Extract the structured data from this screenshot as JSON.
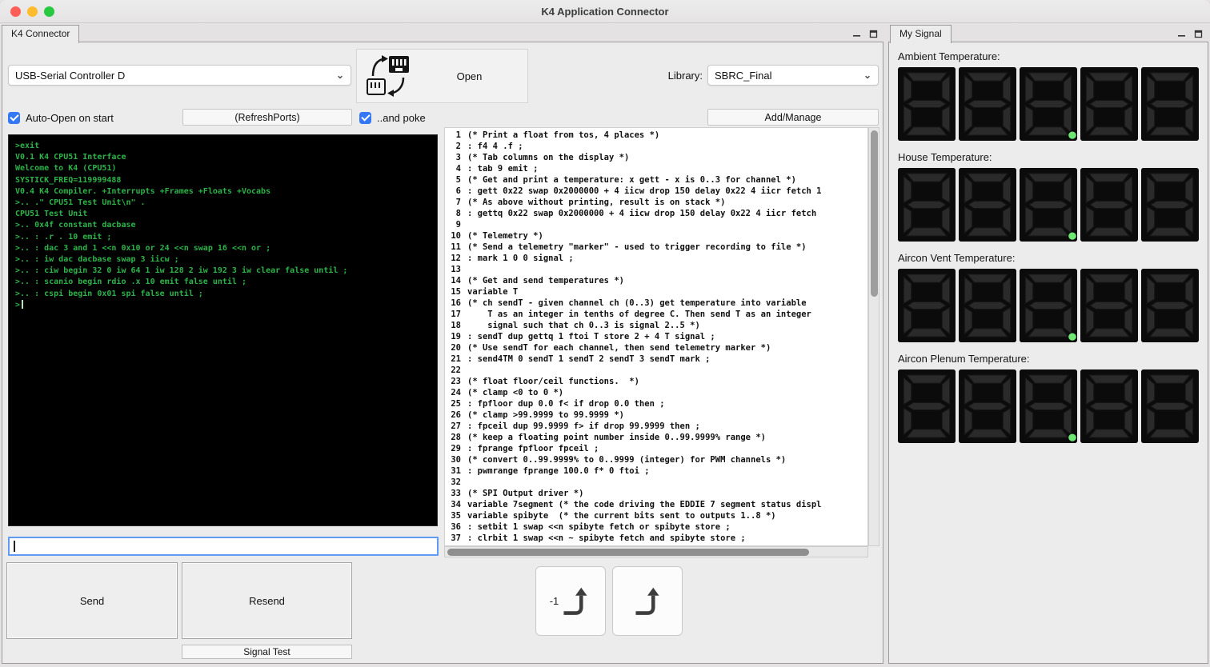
{
  "window": {
    "title": "K4 Application Connector"
  },
  "connector_panel": {
    "tab_label": "K4 Connector",
    "port_dropdown": {
      "value": "USB-Serial Controller D"
    },
    "open_button": {
      "label": "Open"
    },
    "library": {
      "label": "Library:",
      "value": "SBRC_Final"
    },
    "auto_open_checkbox": {
      "label": "Auto-Open on start",
      "checked": true
    },
    "refresh_button": {
      "label": "(RefreshPorts)"
    },
    "poke_checkbox": {
      "label": "..and poke",
      "checked": true
    },
    "add_manage_button": {
      "label": "Add/Manage"
    },
    "terminal": {
      "lines": [
        ">exit",
        "V0.1 K4 CPU51 Interface",
        "Welcome to K4 (CPU51)",
        "SYSTICK_FREQ=119999488",
        "V0.4 K4 Compiler. +Interrupts +Frames +Floats +Vocabs",
        ">.. .\" CPU51 Test Unit\\n\" .",
        "CPU51 Test Unit",
        ">.. 0x4f constant dacbase",
        ">.. : .r . 10 emit ;",
        ">.. : dac 3 and 1 <<n 0x10 or 24 <<n swap 16 <<n or ;",
        ">.. : iw dac dacbase swap 3 iicw ;",
        ">.. : ciw begin 32 0 iw 64 1 iw 128 2 iw 192 3 iw clear false until ;",
        ">.. : scanio begin rdio .x 10 emit false until ;",
        ">.. : cspi begin 0x01 spi false until ;",
        ">"
      ]
    },
    "command_input": {
      "value": "",
      "placeholder": ""
    },
    "send_button": {
      "label": "Send"
    },
    "resend_button": {
      "label": "Resend"
    },
    "signal_test_button": {
      "label": "Signal Test"
    },
    "history_buttons": [
      {
        "label": "-1"
      },
      {
        "label": ""
      }
    ]
  },
  "editor": {
    "lines": [
      "(* Print a float from tos, 4 places *)",
      ": f4 4 .f ;",
      "(* Tab columns on the display *)",
      ": tab 9 emit ;",
      "(* Get and print a temperature: x gett - x is 0..3 for channel *)",
      ": gett 0x22 swap 0x2000000 + 4 iicw drop 150 delay 0x22 4 iicr fetch 1",
      "(* As above without printing, result is on stack *)",
      ": gettq 0x22 swap 0x2000000 + 4 iicw drop 150 delay 0x22 4 iicr fetch",
      "",
      "(* Telemetry *)",
      "(* Send a telemetry \"marker\" - used to trigger recording to file *)",
      ": mark 1 0 0 signal ;",
      "",
      "(* Get and send temperatures *)",
      "variable T",
      "(* ch sendT - given channel ch (0..3) get temperature into variable",
      "    T as an integer in tenths of degree C. Then send T as an integer",
      "    signal such that ch 0..3 is signal 2..5 *)",
      ": sendT dup gettq 1 ftoi T store 2 + 4 T signal ;",
      "(* Use sendT for each channel, then send telemetry marker *)",
      ": send4TM 0 sendT 1 sendT 2 sendT 3 sendT mark ;",
      "",
      "(* float floor/ceil functions.  *)",
      "(* clamp <0 to 0 *)",
      ": fpfloor dup 0.0 f< if drop 0.0 then ;",
      "(* clamp >99.9999 to 99.9999 *)",
      ": fpceil dup 99.9999 f> if drop 99.9999 then ;",
      "(* keep a floating point number inside 0..99.9999% range *)",
      ": fprange fpfloor fpceil ;",
      "(* convert 0..99.9999% to 0..9999 (integer) for PWM channels *)",
      ": pwmrange fprange 100.0 f* 0 ftoi ;",
      "",
      "(* SPI Output driver *)",
      "variable 7segment (* the code driving the EDDIE 7 segment status displ",
      "variable spibyte  (* the current bits sent to outputs 1..8 *)",
      ": setbit 1 swap <<n spibyte fetch or spibyte store ;",
      ": clrbit 1 swap <<n ~ spibyte fetch and spibyte store ;"
    ]
  },
  "signal_panel": {
    "tab_label": "My Signal",
    "groups": [
      {
        "label": "Ambient Temperature:",
        "digit_count": 5,
        "decimal_point_digit": 3
      },
      {
        "label": "House Temperature:",
        "digit_count": 5,
        "decimal_point_digit": 3
      },
      {
        "label": "Aircon Vent Temperature:",
        "digit_count": 5,
        "decimal_point_digit": 3
      },
      {
        "label": "Aircon Plenum Temperature:",
        "digit_count": 5,
        "decimal_point_digit": 3
      }
    ]
  },
  "colors": {
    "accent_blue": "#3478f6",
    "terminal_green": "#2db349",
    "terminal_bg": "#000000",
    "segment_tile": "#0b0b0b",
    "segment_unlit": "#2a2a2a",
    "segment_edge": "#151515",
    "led_green": "#6ee873",
    "traffic_red": "#ff5f57",
    "traffic_yellow": "#febc2e",
    "traffic_green": "#28c840"
  }
}
